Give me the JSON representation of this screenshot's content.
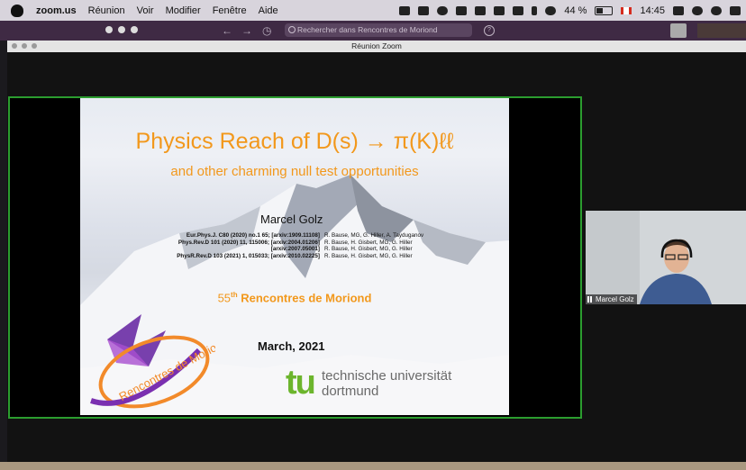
{
  "menubar": {
    "app": "zoom.us",
    "items": [
      "Réunion",
      "Voir",
      "Modifier",
      "Fenêtre",
      "Aide"
    ],
    "battery": "44 %",
    "time": "14:45",
    "battery_level": 0.44
  },
  "browser": {
    "search_placeholder": "Rechercher dans Rencontres de Moriond"
  },
  "window": {
    "title": "Réunion Zoom"
  },
  "slide": {
    "title": "Physics Reach of D(s) → π(K)ℓℓ",
    "subtitle": "and other charming null test opportunities",
    "author": "Marcel Golz",
    "references": [
      {
        "journal": "Eur.Phys.J. C80 (2020) no.1 65; [arxiv:1909.11108]",
        "authors": "R. Bause, MG, G. Hiller, A. Tayduganov"
      },
      {
        "journal": "Phys.Rev.D 101 (2020) 11, 115006; [arxiv:2004.01206]",
        "authors": "R. Bause, H. Gisbert, MG, G. Hiller"
      },
      {
        "journal": "[arxiv:2007.05001]",
        "authors": "R. Bause, H. Gisbert, MG, G. Hiller"
      },
      {
        "journal": "PhysR.Rev.D 103 (2021) 1, 015033; [arxiv:2010.02225]",
        "authors": "R. Bause, H. Gisbert, MG, G. Hiller"
      }
    ],
    "conference_number": "55",
    "conference_suffix": "th",
    "conference_name": "Rencontres de Moriond",
    "date": "March, 2021",
    "logo_letters": "tu",
    "university_line1": "technische universität",
    "university_line2": "dortmund",
    "moriond_logo_text": "Rencontres de Moriond"
  },
  "participant": {
    "name": "Marcel Golz"
  },
  "colors": {
    "accent_orange": "#f2981c",
    "share_border": "#2b9d2f",
    "tu_green": "#6cb52d"
  }
}
